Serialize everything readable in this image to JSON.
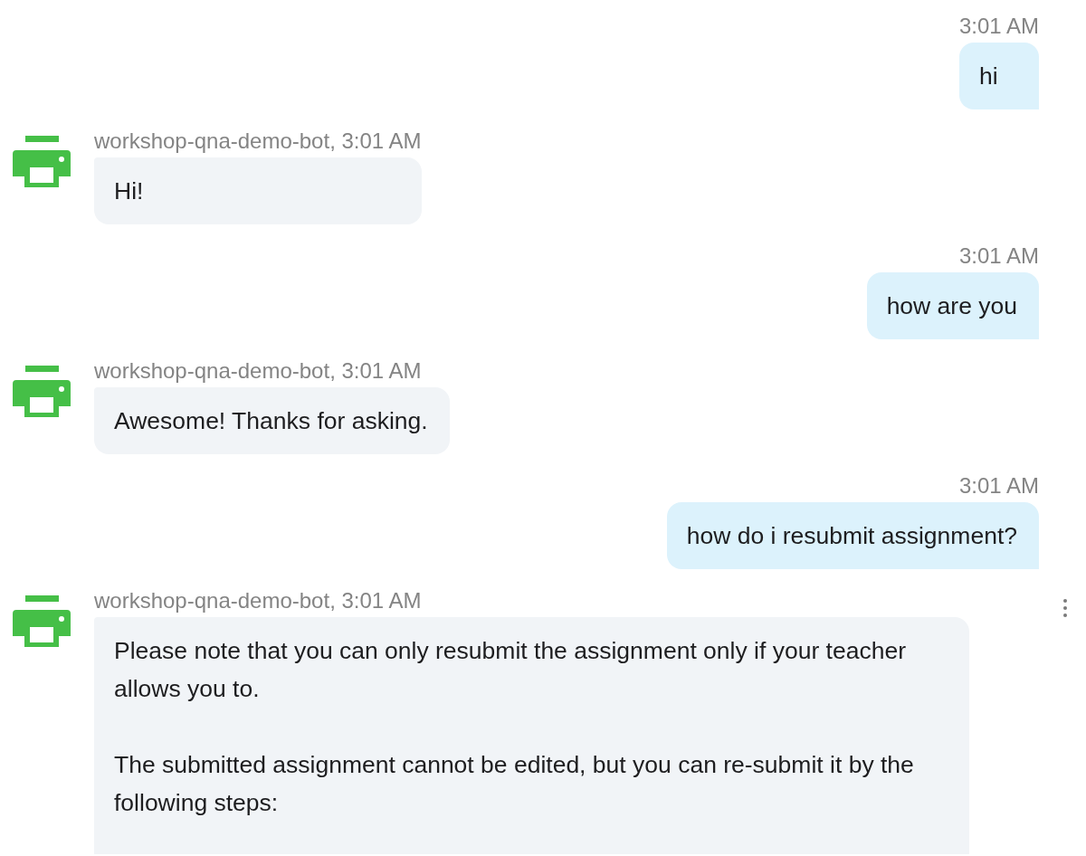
{
  "messages": [
    {
      "kind": "user",
      "timestamp": "3:01 AM",
      "paragraphs": [
        "hi"
      ],
      "menu_visible": false,
      "truncated": false
    },
    {
      "kind": "bot",
      "header": "workshop-qna-demo-bot, 3:01 AM",
      "paragraphs": [
        "Hi!"
      ],
      "menu_visible": false,
      "truncated": false
    },
    {
      "kind": "user",
      "timestamp": "3:01 AM",
      "paragraphs": [
        "how are you"
      ],
      "menu_visible": false,
      "truncated": false
    },
    {
      "kind": "bot",
      "header": "workshop-qna-demo-bot, 3:01 AM",
      "paragraphs": [
        "Awesome! Thanks for asking."
      ],
      "menu_visible": false,
      "truncated": false
    },
    {
      "kind": "user",
      "timestamp": "3:01 AM",
      "paragraphs": [
        "how do i resubmit assignment?"
      ],
      "menu_visible": false,
      "truncated": false
    },
    {
      "kind": "bot",
      "header": "workshop-qna-demo-bot, 3:01 AM",
      "paragraphs": [
        "Please note that you can only resubmit the assignment only if your teacher allows you to.",
        "The submitted assignment cannot be edited, but you can re-submit it by the following steps:"
      ],
      "menu_visible": true,
      "truncated": true
    }
  ]
}
